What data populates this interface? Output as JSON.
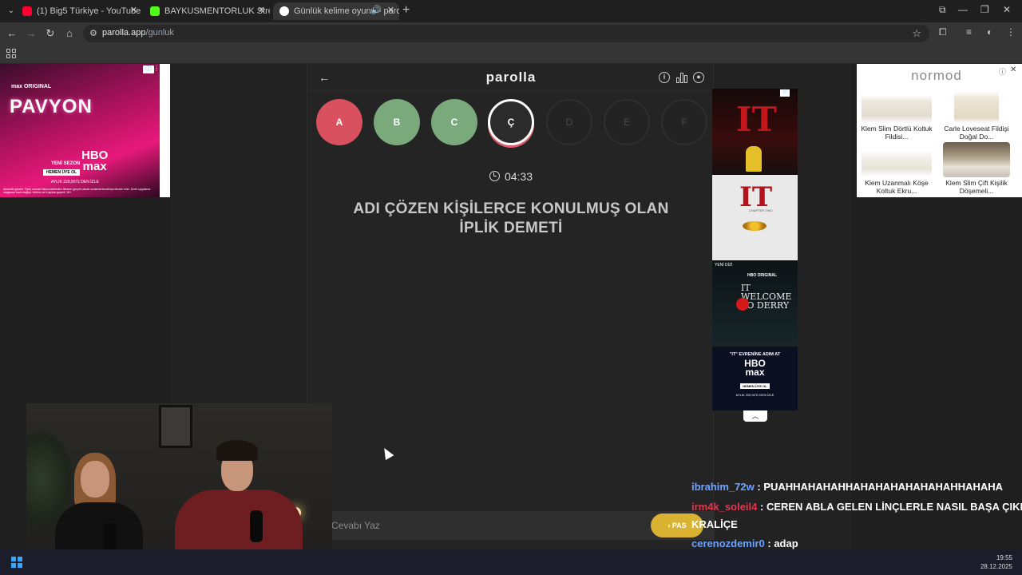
{
  "browser": {
    "tabs": [
      {
        "title": "(1) Big5 Türkiye - YouTube",
        "icon": "youtube-icon",
        "color": "#ff0033"
      },
      {
        "title": "BAYKUSMENTORLUK Stream - ",
        "icon": "kick-icon",
        "color": "#53fc18"
      },
      {
        "title": "Günlük kelime oyunu - paro",
        "icon": "parolla-icon",
        "color": "#ffffff"
      }
    ],
    "url_host": "parolla.app",
    "url_path": "/gunluk"
  },
  "ads": {
    "left": {
      "brand_small": "max ORIGINAL",
      "title": "PAVYON",
      "season": "YENİ SEZON",
      "hbo_line1": "HBO",
      "hbo_line2": "max",
      "cta": "HEMEN ÜYE OL",
      "price": "AYLIK 229,90TL'DEN İZLE",
      "legal": "Abonelik gerekir. Fiyat, sonraki fatura tarihinden itibaren geçerli olarak sonlandırılmadıkça devam eder. Ücret uygulama mağazası bazlı değişir. Hüküm ve Koşullar geçerli. 18+"
    },
    "right": {
      "brand": "normod",
      "products": [
        {
          "label": "Klem Slim Dörtlü Koltuk Fildisi..."
        },
        {
          "label": "Carle Loveseat Fildişi Doğal Do..."
        },
        {
          "label": "Klem Uzanmalı Köşe Koltuk Ekru..."
        },
        {
          "label": "Klem Slim Çift Kişilik Döşemeli..."
        }
      ]
    },
    "vertical": {
      "p1_title": "IT",
      "p2_title": "IT",
      "p2_sub": "CHAPTER TWO",
      "p3_badge": "YENİ DİZİ",
      "p3_brand": "HBO ORIGINAL",
      "p3_title": "IT WELCOME TO DERRY",
      "p4_line": "\"IT\" EVRENİNE ADIM AT",
      "p4_hbo1": "HBO",
      "p4_hbo2": "max",
      "p4_cta": "HEMEN ÜYE OL",
      "p4_price": "AYLIK 229,90TL'DEN İZLE"
    }
  },
  "game": {
    "logo": "parolla",
    "letters": [
      {
        "letter": "A",
        "state": "wrong"
      },
      {
        "letter": "B",
        "state": "correct"
      },
      {
        "letter": "C",
        "state": "correct"
      },
      {
        "letter": "Ç",
        "state": "current"
      },
      {
        "letter": "D",
        "state": "pending"
      },
      {
        "letter": "E",
        "state": "pending"
      },
      {
        "letter": "F",
        "state": "pending"
      }
    ],
    "timer": "04:33",
    "question": "ADI ÇÖZEN KİŞİLERCE KONULMUŞ OLAN İPLİK DEMETİ",
    "answer_placeholder": "Cevabı Yaz",
    "pass_label": "PAS",
    "colors": {
      "wrong": "#d9505e",
      "correct": "#7aa97b",
      "accent": "#d9b232"
    }
  },
  "chat": [
    {
      "user": "ibrahim_72w",
      "color": "#6aa0ff",
      "message": " : PUAHHAHAHAHHAHAHAHAHAHAHAHHAHAHA"
    },
    {
      "user": "irm4k_soleil4",
      "color": "#e0364f",
      "message": " : CEREN ABLA GELEN LİNÇLERLE NASIL BAŞA ÇIKIYO"
    },
    {
      "user": "",
      "color": "#ffffff",
      "message": "KRALİÇE"
    },
    {
      "user": "cerenozdemir0",
      "color": "#6aa0ff",
      "message": " : adap"
    }
  ],
  "taskbar": {
    "time": "19:55",
    "date": "28.12.2025"
  }
}
